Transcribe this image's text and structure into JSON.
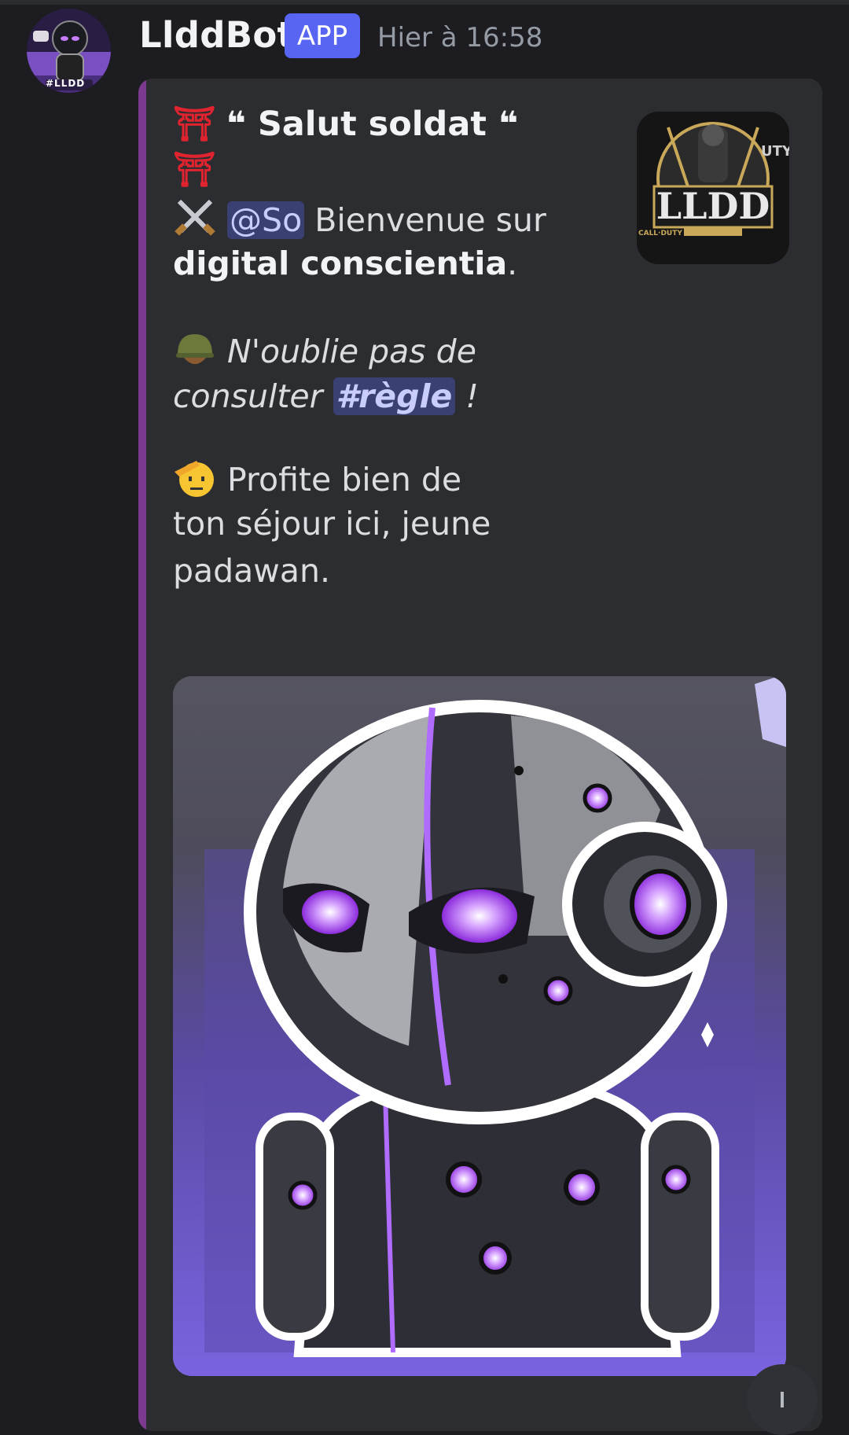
{
  "message": {
    "author": "LlddBot",
    "badge": "APP",
    "timestamp": "Hier à 16:58",
    "avatar_icon": "robot-avatar-icon",
    "avatar_text": "#LLDD"
  },
  "embed": {
    "accent_color": "#7b3a8e",
    "title": "Salut soldat",
    "title_emoji_left": "⛩",
    "title_quote": "❝",
    "mention": "@So",
    "welcome_text": "Bienvenue sur",
    "server_name": "digital conscientia",
    "server_suffix": ".",
    "rules_line_1": "N'oublie pas de",
    "rules_line_2": "consulter",
    "rules_channel": "#règle",
    "rules_suffix": " !",
    "enjoy_line_1": "Profite bien de",
    "enjoy_line_2": "ton séjour ici, jeune",
    "enjoy_line_3": "padawan.",
    "thumbnail_text": "LLDD",
    "thumbnail_caption": "CALL·DUTY",
    "thumbnail_side_text": "UTY",
    "image_icon": "robot-mascot-image"
  }
}
